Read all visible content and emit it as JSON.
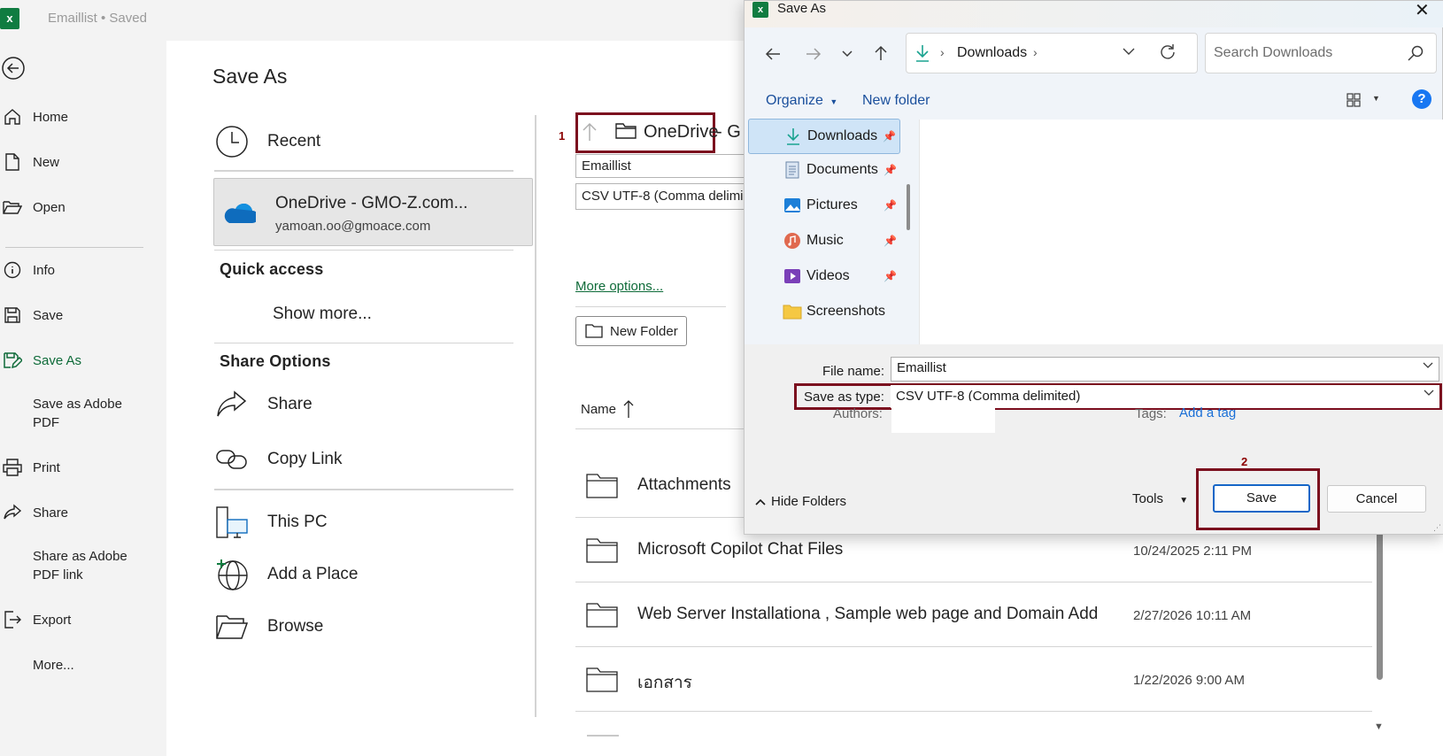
{
  "app": {
    "doc_title": "Emaillist • Saved",
    "logo_letter": "x"
  },
  "nav": {
    "items": [
      {
        "label": "Home"
      },
      {
        "label": "New"
      },
      {
        "label": "Open"
      },
      {
        "label": "Info"
      },
      {
        "label": "Save"
      },
      {
        "label": "Save As"
      },
      {
        "label": "Save as Adobe PDF"
      },
      {
        "label": "Print"
      },
      {
        "label": "Share"
      },
      {
        "label": "Share as Adobe PDF link"
      },
      {
        "label": "Export"
      },
      {
        "label": "More..."
      }
    ]
  },
  "backstage": {
    "title": "Save As",
    "recent": "Recent",
    "onedrive_title": "OneDrive - GMO-Z.com...",
    "onedrive_email": "yamoan.oo@gmoace.com",
    "quick_access": "Quick access",
    "show_more": "Show more...",
    "share_options": "Share Options",
    "share": "Share",
    "copy_link": "Copy Link",
    "this_pc": "This PC",
    "add_place": "Add a Place",
    "browse": "Browse"
  },
  "filepane": {
    "annotation_1": "1",
    "path_label": "OneDrive",
    "path_suffix": "- G",
    "filename_value": "Emaillist",
    "filetype_value": "CSV UTF-8 (Comma delimi",
    "more_options": "More options...",
    "new_folder": "New Folder",
    "name_header": "Name",
    "files": [
      {
        "name": "Attachments",
        "date": ""
      },
      {
        "name": "Microsoft Copilot Chat Files",
        "date": "10/24/2025 2:11 PM"
      },
      {
        "name": "Web Server Installationa , Sample web page and Domain Add",
        "date": "2/27/2026 10:11 AM"
      },
      {
        "name": "เอกสาร",
        "date": "1/22/2026 9:00 AM"
      }
    ]
  },
  "dialog": {
    "title": "Save As",
    "close": "✕",
    "address": "Downloads",
    "search_placeholder": "Search Downloads",
    "organize": "Organize",
    "new_folder": "New folder",
    "help": "?",
    "tree": [
      {
        "label": "Downloads",
        "icon": "download-icon",
        "pinned": true
      },
      {
        "label": "Documents",
        "icon": "documents-icon",
        "pinned": true
      },
      {
        "label": "Pictures",
        "icon": "pictures-icon",
        "pinned": true
      },
      {
        "label": "Music",
        "icon": "music-icon",
        "pinned": true
      },
      {
        "label": "Videos",
        "icon": "videos-icon",
        "pinned": true
      },
      {
        "label": "Screenshots",
        "icon": "folder-icon",
        "pinned": false
      }
    ],
    "file_name_label": "File name:",
    "file_name_value": "Emaillist",
    "save_type_label": "Save as type:",
    "save_type_value": "CSV UTF-8 (Comma delimited)",
    "authors_label": "Authors:",
    "tags_label": "Tags:",
    "add_tag": "Add a tag",
    "hide_folders": "Hide Folders",
    "tools": "Tools",
    "save": "Save",
    "cancel": "Cancel",
    "annotation_2": "2"
  },
  "colors": {
    "excel_green": "#107c41",
    "active_nav": "#0e6b39",
    "highlight_border": "#7b0e1e",
    "link_blue": "#1a6fd6"
  }
}
